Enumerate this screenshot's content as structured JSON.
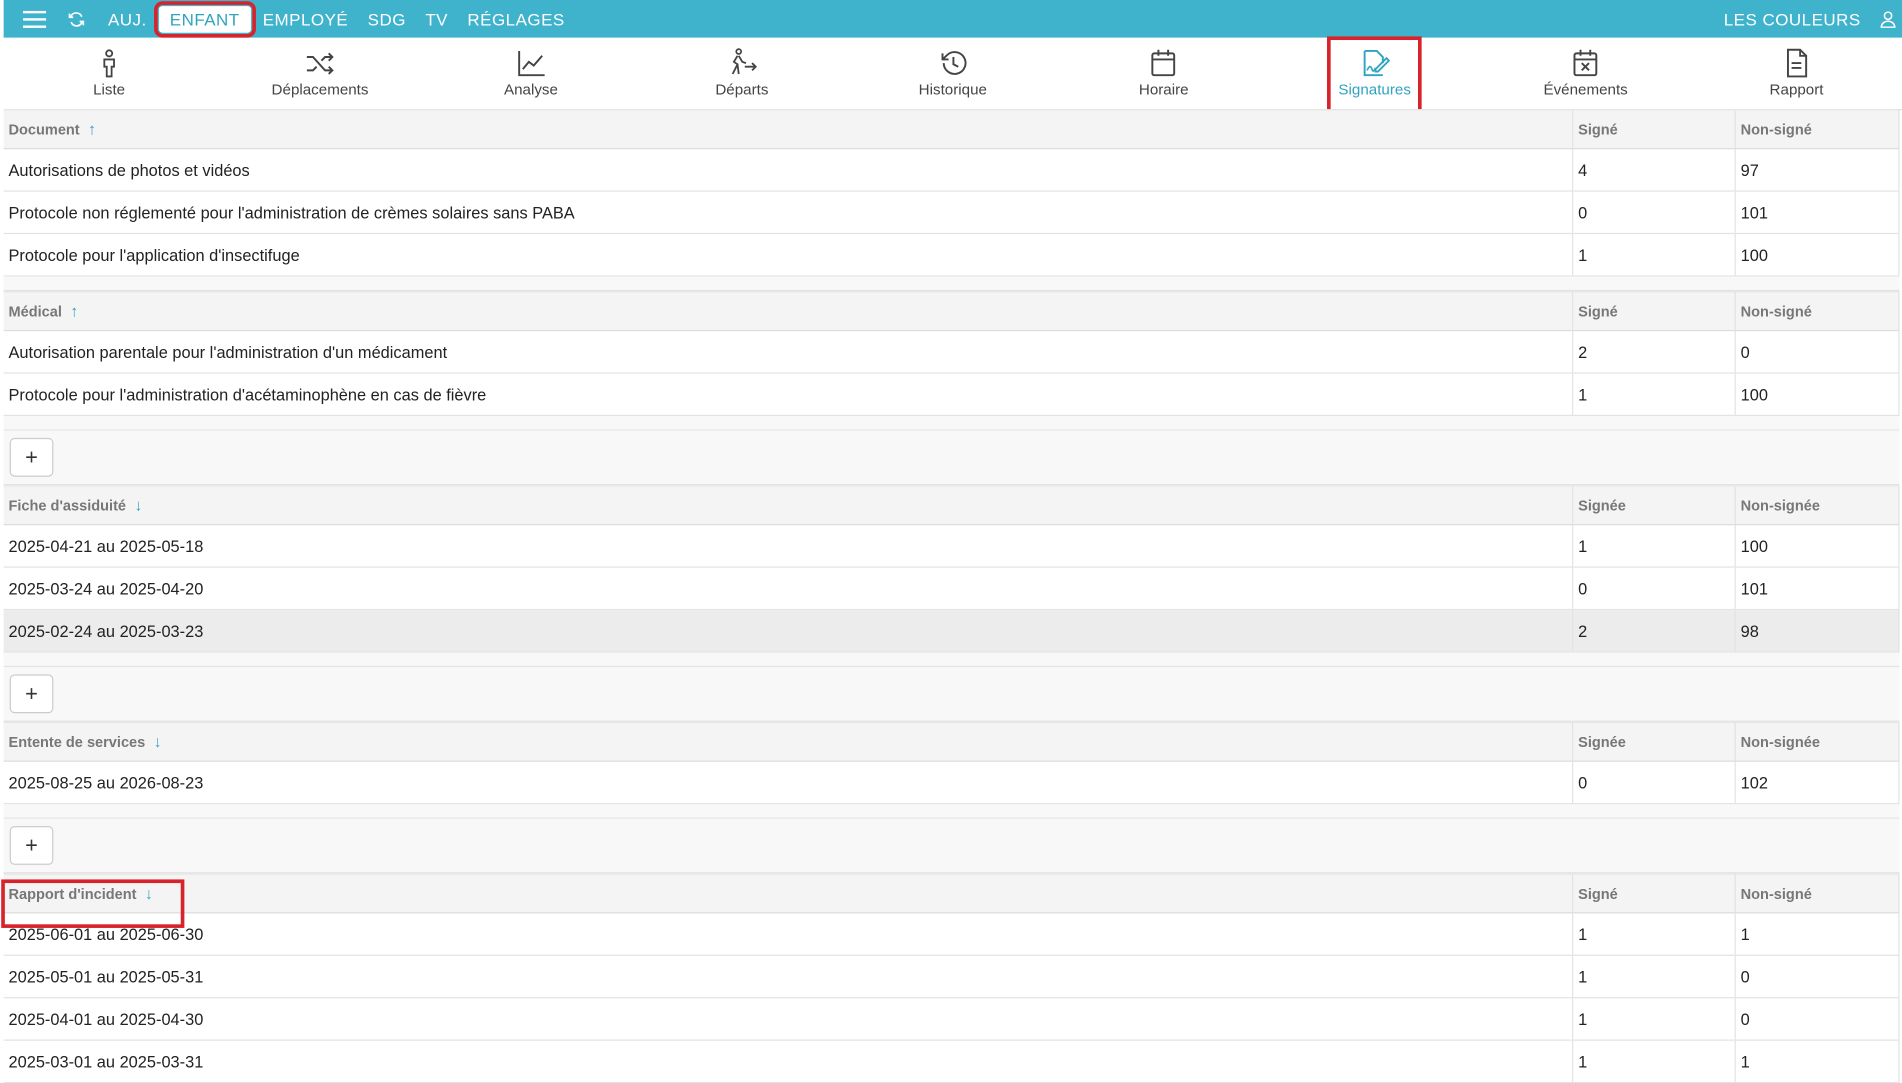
{
  "topbar": {
    "nav": [
      "AUJ.",
      "ENFANT",
      "EMPLOYÉ",
      "SDG",
      "TV",
      "RÉGLAGES"
    ],
    "active": "ENFANT",
    "right_label": "LES COULEURS"
  },
  "tabs": [
    {
      "label": "Liste",
      "icon": "person-icon"
    },
    {
      "label": "Déplacements",
      "icon": "shuffle-icon"
    },
    {
      "label": "Analyse",
      "icon": "chart-line-icon"
    },
    {
      "label": "Départs",
      "icon": "walking-arrow-icon"
    },
    {
      "label": "Historique",
      "icon": "history-icon"
    },
    {
      "label": "Horaire",
      "icon": "calendar-icon"
    },
    {
      "label": "Signatures",
      "icon": "signature-icon"
    },
    {
      "label": "Événements",
      "icon": "calendar-x-icon"
    },
    {
      "label": "Rapport",
      "icon": "document-icon"
    }
  ],
  "active_tab": "Signatures",
  "accent_color": "#3fb2cc",
  "sections": [
    {
      "title": "Document",
      "sort": "up",
      "col_signed": "Signé",
      "col_unsigned": "Non-signé",
      "rows": [
        {
          "name": "Autorisations de photos et vidéos",
          "signed": "4",
          "unsigned": "97"
        },
        {
          "name": "Protocole non réglementé pour l'administration de crèmes solaires sans PABA",
          "signed": "0",
          "unsigned": "101"
        },
        {
          "name": "Protocole pour l'application d'insectifuge",
          "signed": "1",
          "unsigned": "100"
        }
      ]
    },
    {
      "title": "Médical",
      "sort": "up",
      "col_signed": "Signé",
      "col_unsigned": "Non-signé",
      "rows": [
        {
          "name": "Autorisation parentale pour l'administration d'un médicament",
          "signed": "2",
          "unsigned": "0"
        },
        {
          "name": "Protocole pour l'administration d'acétaminophène en cas de fièvre",
          "signed": "1",
          "unsigned": "100"
        }
      ]
    },
    {
      "title": "Fiche d'assiduité",
      "sort": "down",
      "col_signed": "Signée",
      "col_unsigned": "Non-signée",
      "rows": [
        {
          "name": "2025-04-21 au 2025-05-18",
          "signed": "1",
          "unsigned": "100"
        },
        {
          "name": "2025-03-24 au 2025-04-20",
          "signed": "0",
          "unsigned": "101"
        },
        {
          "name": "2025-02-24 au 2025-03-23",
          "signed": "2",
          "unsigned": "98"
        }
      ]
    },
    {
      "title": "Entente de services",
      "sort": "down",
      "col_signed": "Signée",
      "col_unsigned": "Non-signée",
      "rows": [
        {
          "name": "2025-08-25 au 2026-08-23",
          "signed": "0",
          "unsigned": "102"
        }
      ]
    },
    {
      "title": "Rapport d'incident",
      "sort": "down",
      "col_signed": "Signé",
      "col_unsigned": "Non-signé",
      "rows": [
        {
          "name": "2025-06-01 au 2025-06-30",
          "signed": "1",
          "unsigned": "1"
        },
        {
          "name": "2025-05-01 au 2025-05-31",
          "signed": "1",
          "unsigned": "0"
        },
        {
          "name": "2025-04-01 au 2025-04-30",
          "signed": "1",
          "unsigned": "0"
        },
        {
          "name": "2025-03-01 au 2025-03-31",
          "signed": "1",
          "unsigned": "1"
        }
      ]
    }
  ],
  "add_label": "+"
}
